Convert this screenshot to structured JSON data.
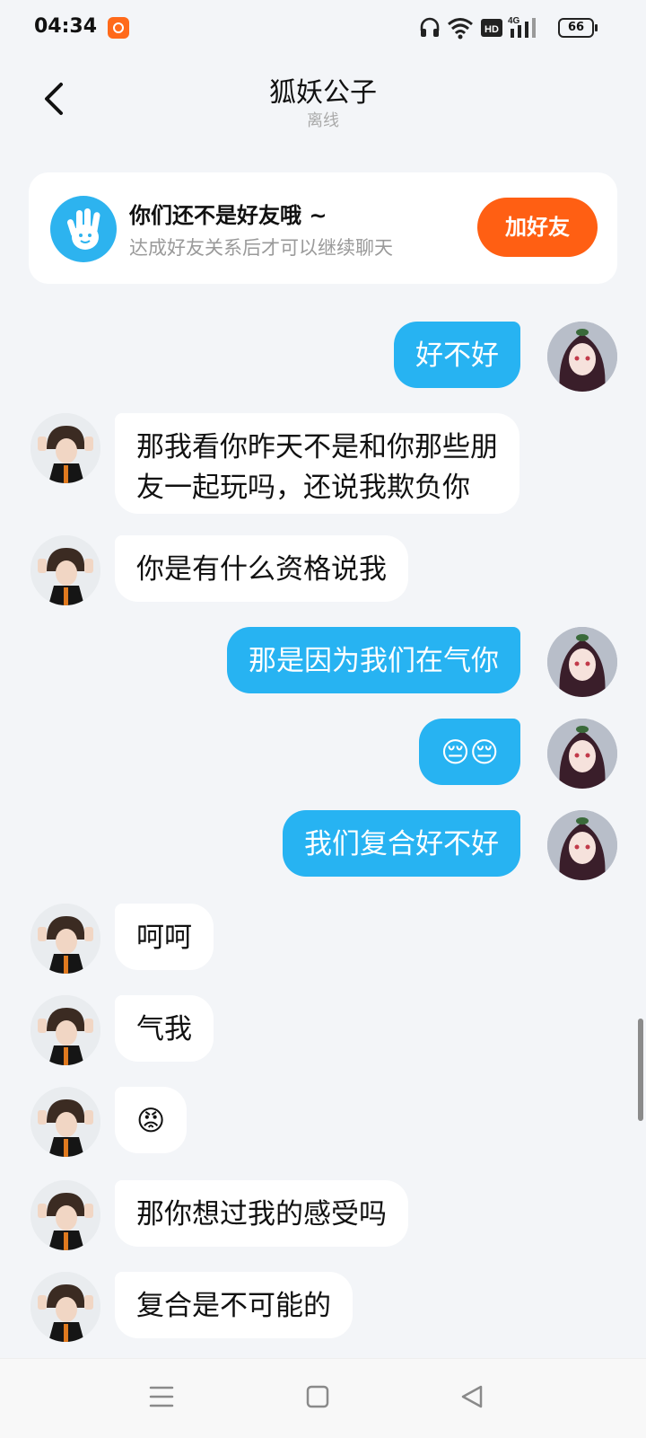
{
  "status_bar": {
    "time": "04:34",
    "app_badge_icon": "kuaishou-app-icon",
    "icons": [
      "headphones-icon",
      "wifi-icon",
      "hd-icon",
      "4g-signal-icon"
    ],
    "battery_level": "66"
  },
  "header": {
    "back_icon": "chevron-left-icon",
    "title": "狐妖公子",
    "status": "离线"
  },
  "friend_card": {
    "icon": "waving-hand-icon",
    "title": "你们还不是好友哦 ~",
    "subtitle": "达成好友关系后才可以继续聊天",
    "add_label": "加好友",
    "accent": "#ff5f13"
  },
  "messages": [
    {
      "side": "out",
      "text": "好不好"
    },
    {
      "side": "in",
      "line1": "那我看你昨天不是和你那些朋",
      "line2": "友一起玩吗，还说我欺负你"
    },
    {
      "side": "in",
      "text": "你是有什么资格说我"
    },
    {
      "side": "out",
      "text": "那是因为我们在气你"
    },
    {
      "side": "out",
      "text": "😔😔"
    },
    {
      "side": "out",
      "text": "我们复合好不好"
    },
    {
      "side": "in",
      "text": "呵呵"
    },
    {
      "side": "in",
      "text": "气我"
    },
    {
      "side": "in",
      "text": "😡"
    },
    {
      "side": "in",
      "text": "那你想过我的感受吗"
    },
    {
      "side": "in",
      "text": "复合是不可能的"
    }
  ],
  "colors": {
    "outgoing_bubble": "#27b3f2",
    "incoming_bubble": "#ffffff",
    "background": "#f3f5f8"
  },
  "nav_bar": {
    "icons": [
      "menu-icon",
      "home-square-icon",
      "back-triangle-icon"
    ]
  }
}
